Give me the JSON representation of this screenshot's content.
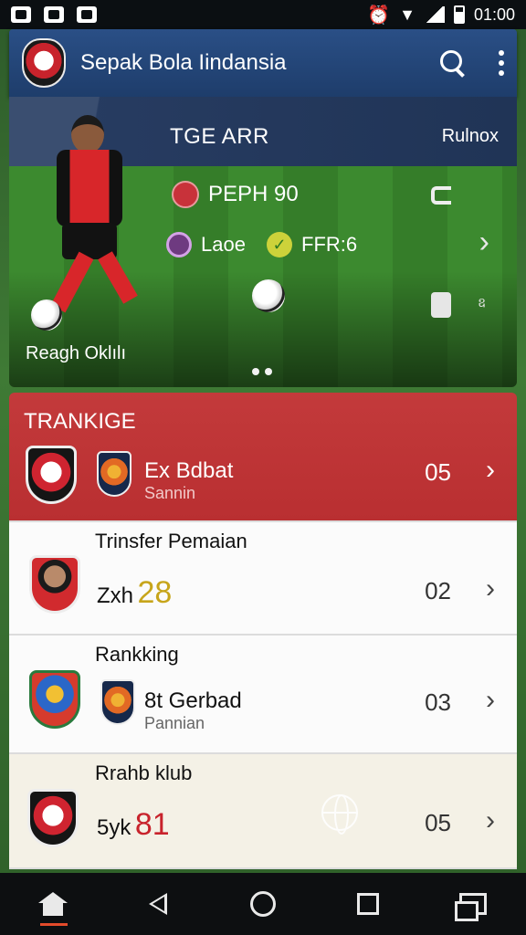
{
  "status_bar": {
    "time": "01:00"
  },
  "app_bar": {
    "title": "Sepak Bola Iindansia"
  },
  "hero": {
    "title": "TGE ARR",
    "right_label": "Rulnox",
    "stat_1": "PEPH  90",
    "stat_2": "Laoe",
    "stat_3": "FFR:6",
    "mini_label": "ឧ",
    "caption": "Reagh Oklılı"
  },
  "list": {
    "rows": [
      {
        "title": "TRANKIGE",
        "name": "Ex Bdbat",
        "sub": "Sannin",
        "count": "05"
      },
      {
        "caption": "Trinsfer Pemaian",
        "name": "Zxh",
        "number": "28",
        "count": "02"
      },
      {
        "caption": "Rankking",
        "name": "8t Gerbad",
        "sub": "Pannian",
        "count": "03"
      },
      {
        "caption": "Rrahb klub",
        "name": "5yk",
        "number": "81",
        "count": "05"
      }
    ]
  },
  "colors": {
    "accent_red": "#c33a3b",
    "app_bar_blue": "#2a4f86",
    "nav_bg": "#0d0f11"
  }
}
